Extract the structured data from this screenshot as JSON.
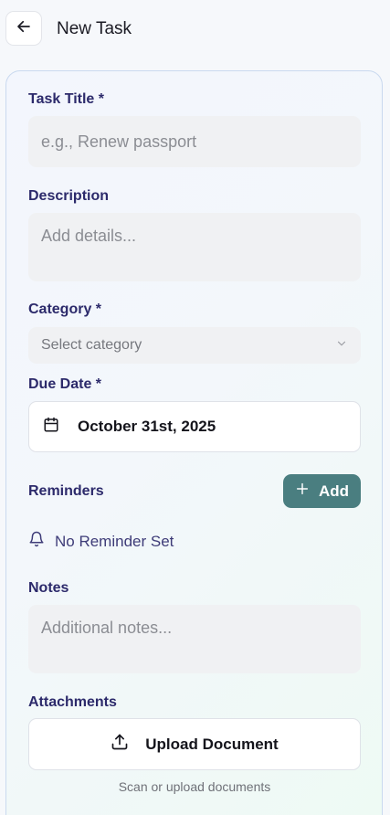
{
  "header": {
    "title": "New Task",
    "back_icon": "arrow-left-icon"
  },
  "form": {
    "task_title": {
      "label": "Task Title *",
      "placeholder": "e.g., Renew passport",
      "value": ""
    },
    "description": {
      "label": "Description",
      "placeholder": "Add details...",
      "value": ""
    },
    "category": {
      "label": "Category *",
      "selected_text": "Select category",
      "icon": "chevron-down-icon"
    },
    "due_date": {
      "label": "Due Date *",
      "value": "October 31st, 2025",
      "icon": "calendar-icon"
    },
    "reminders": {
      "label": "Reminders",
      "add_label": "Add",
      "add_icon": "plus-icon",
      "status_text": "No Reminder Set",
      "status_icon": "bell-icon"
    },
    "notes": {
      "label": "Notes",
      "placeholder": "Additional notes...",
      "value": ""
    },
    "attachments": {
      "label": "Attachments",
      "upload_label": "Upload Document",
      "upload_icon": "upload-icon",
      "hint": "Scan or upload documents"
    }
  },
  "colors": {
    "label": "#2c2a6b",
    "primary_button": "#4a7e80",
    "field_bg": "#f0f1f3",
    "card_border": "#c9d9ef"
  }
}
